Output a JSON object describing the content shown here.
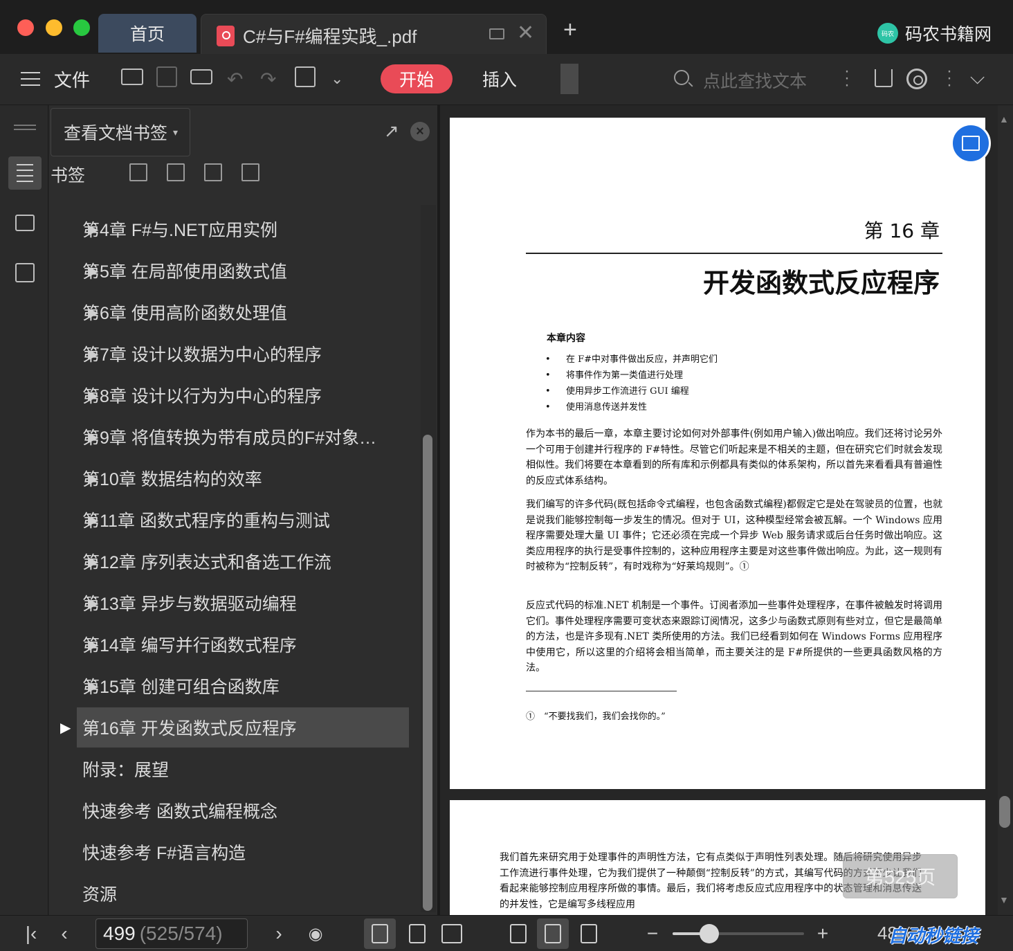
{
  "window": {
    "tabs": [
      {
        "label": "首页"
      },
      {
        "label": "C#与F#编程实践_.pdf"
      }
    ],
    "brand": {
      "logo_text": "码农",
      "name": "码农书籍网"
    }
  },
  "toolbar": {
    "menu_label": "文件",
    "tab_start": "开始",
    "tab_insert": "插入",
    "search_placeholder": "点此查找文本",
    "accent_color": "#e94b57"
  },
  "bookmark_panel": {
    "view_selector": "查看文档书签",
    "section_label": "书签",
    "items": [
      {
        "label": "第4章 F#与.NET应用实例",
        "expandable": true
      },
      {
        "label": "第5章 在局部使用函数式值",
        "expandable": true
      },
      {
        "label": "第6章 使用高阶函数处理值",
        "expandable": true
      },
      {
        "label": "第7章 设计以数据为中心的程序",
        "expandable": true
      },
      {
        "label": "第8章 设计以行为为中心的程序",
        "expandable": true
      },
      {
        "label": "第9章 将值转换为带有成员的F#对象…",
        "expandable": true
      },
      {
        "label": "第10章 数据结构的效率",
        "expandable": true
      },
      {
        "label": "第11章 函数式程序的重构与测试",
        "expandable": true
      },
      {
        "label": "第12章 序列表达式和备选工作流",
        "expandable": true
      },
      {
        "label": "第13章 异步与数据驱动编程",
        "expandable": true
      },
      {
        "label": "第14章 编写并行函数式程序",
        "expandable": true
      },
      {
        "label": "第15章 创建可组合函数库",
        "expandable": true
      },
      {
        "label": "第16章 开发函数式反应程序",
        "expandable": true,
        "selected": true
      },
      {
        "label": "附录：展望",
        "expandable": false
      },
      {
        "label": "快速参考 函数式编程概念",
        "expandable": false
      },
      {
        "label": "快速参考 F#语言构造",
        "expandable": false
      },
      {
        "label": "资源",
        "expandable": false
      }
    ]
  },
  "document": {
    "chapter": "第 16 章",
    "title": "开发函数式反应程序",
    "contents_heading": "本章内容",
    "bullets": [
      "在 F#中对事件做出反应，并声明它们",
      "将事件作为第一类值进行处理",
      "使用异步工作流进行 GUI 编程",
      "使用消息传送并发性"
    ],
    "paragraphs": [
      "作为本书的最后一章，本章主要讨论如何对外部事件(例如用户输入)做出响应。我们还将讨论另外一个可用于创建并行程序的 F#特性。尽管它们听起来是不相关的主题，但在研究它们时就会发现相似性。我们将要在本章看到的所有库和示例都具有类似的体系架构，所以首先来看看具有普遍性的反应式体系结构。",
      "我们编写的许多代码(既包括命令式编程，也包含函数式编程)都假定它是处在驾驶员的位置，也就是说我们能够控制每一步发生的情况。但对于 UI，这种模型经常会被瓦解。一个 Windows 应用程序需要处理大量 UI 事件；它还必须在完成一个异步 Web 服务请求或后台任务时做出响应。这类应用程序的执行是受事件控制的，这种应用程序主要是对这些事件做出响应。为此，这一规则有时被称为“控制反转”，有时戏称为“好莱坞规则”。①",
      "反应式代码的标准.NET 机制是一个事件。订阅者添加一些事件处理程序，在事件被触发时将调用它们。事件处理程序需要可变状态来跟踪订阅情况，这多少与函数式原则有些对立，但它是最简单的方法，也是许多现有.NET 类所使用的方法。我们已经看到如何在 Windows Forms 应用程序中使用它，所以这里的介绍将会相当简单，而主要关注的是 F#所提供的一些更具函数风格的方法。"
    ],
    "footnote": "①　“不要找我们，我们会找你的。”",
    "page2_text": "我们首先来研究用于处理事件的声明性方法，它有点类似于声明性列表处理。随后将研究使用异步工作流进行事件处理，它为我们提供了一种颠倒“控制反转”的方式，其编写代码的方式至少让我们看起来能够控制应用程序所做的事情。最后，我们将考虑反应式应用程序中的状态管理和消息传送的并发性，它是编写多线程应用"
  },
  "page_indicator": "第525页",
  "status": {
    "current_page": "499",
    "page_detail": "(525/574)",
    "zoom_text": "48%",
    "zoom_level": 0.28
  },
  "watermark": "自动秒链接"
}
